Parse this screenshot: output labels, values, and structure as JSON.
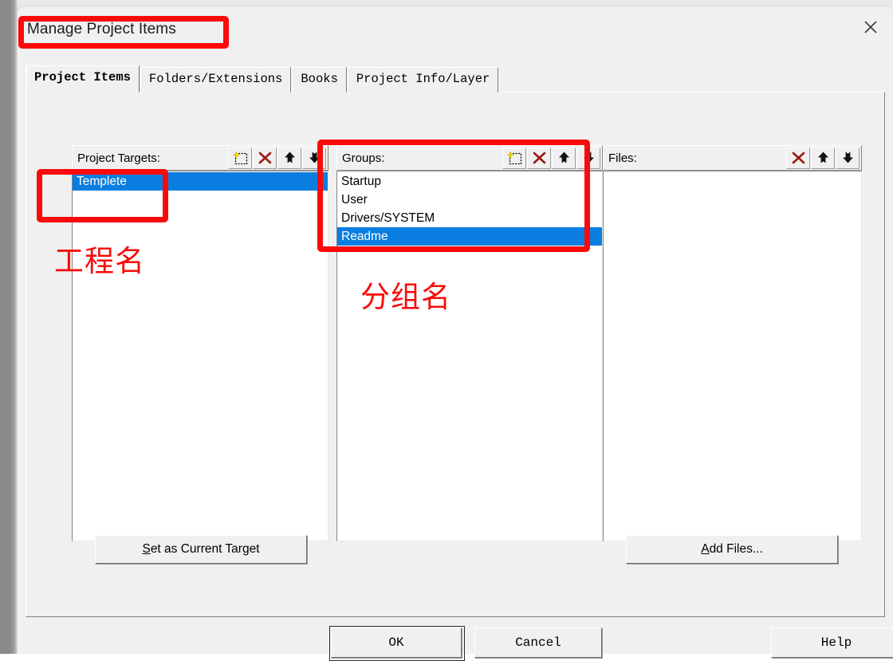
{
  "window": {
    "title": "Manage Project Items",
    "close_icon": "close-icon"
  },
  "tabs": [
    {
      "label": "Project Items",
      "active": true
    },
    {
      "label": "Folders/Extensions",
      "active": false
    },
    {
      "label": "Books",
      "active": false
    },
    {
      "label": "Project Info/Layer",
      "active": false
    }
  ],
  "panels": {
    "targets": {
      "label": "Project Targets:",
      "tools": [
        {
          "name": "new-item-icon",
          "title": "New (Insert)"
        },
        {
          "name": "delete-icon",
          "title": "Remove"
        },
        {
          "name": "arrow-up-icon",
          "title": "Move Up"
        },
        {
          "name": "arrow-down-icon",
          "title": "Move Down"
        }
      ],
      "items": [
        {
          "text": "Templete",
          "selected": true
        }
      ]
    },
    "groups": {
      "label": "Groups:",
      "tools": [
        {
          "name": "new-item-icon",
          "title": "New (Insert)"
        },
        {
          "name": "delete-icon",
          "title": "Remove"
        },
        {
          "name": "arrow-up-icon",
          "title": "Move Up"
        },
        {
          "name": "arrow-down-icon",
          "title": "Move Down"
        }
      ],
      "items": [
        {
          "text": "Startup",
          "selected": false
        },
        {
          "text": "User",
          "selected": false
        },
        {
          "text": "Drivers/SYSTEM",
          "selected": false
        },
        {
          "text": "Readme",
          "selected": true
        }
      ]
    },
    "files": {
      "label": "Files:",
      "tools": [
        {
          "name": "delete-icon",
          "title": "Remove"
        },
        {
          "name": "arrow-up-icon",
          "title": "Move Up"
        },
        {
          "name": "arrow-down-icon",
          "title": "Move Down"
        }
      ],
      "items": []
    }
  },
  "buttons": {
    "set_as_current_target": {
      "accel": "S",
      "rest": "et as Current Target"
    },
    "add_files": {
      "accel": "A",
      "rest": "dd Files..."
    },
    "ok": "OK",
    "cancel": "Cancel",
    "help": "Help"
  },
  "annotations": {
    "project_name": "工程名",
    "group_name": "分组名",
    "color": "#fa0a0a"
  },
  "colors": {
    "selection_blue": "#0a7ee0",
    "dialog_face": "#f0f0f0",
    "list_background": "#ffffff",
    "delete_icon_red": "#9b1b12",
    "new_icon_yellow": "#f5e000"
  }
}
